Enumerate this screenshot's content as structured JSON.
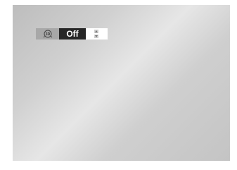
{
  "osd": {
    "mode_icon": "3d-sound-icon",
    "mode_icon_label": "3D",
    "value": "Off",
    "arrows": [
      "up-arrow-icon",
      "down-arrow-icon"
    ]
  }
}
